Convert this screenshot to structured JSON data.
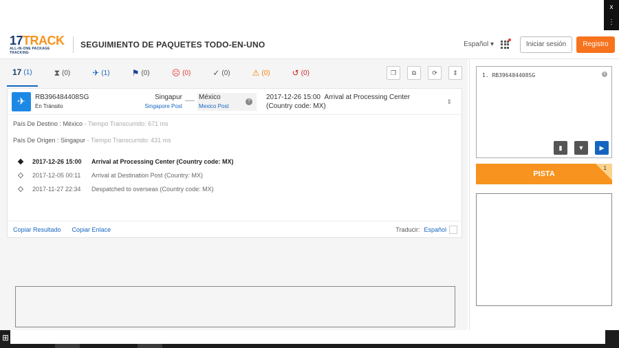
{
  "window": {
    "close": "x",
    "menu": "⋮"
  },
  "header": {
    "logo_main_1": "17",
    "logo_main_2": "TRACK",
    "logo_sub": "ALL-IN-ONE PACKAGE TRACKING",
    "title": "SEGUIMIENTO DE PAQUETES TODO-EN-UNO",
    "language": "Español ▾",
    "login": "Iniciar sesión",
    "register": "Registro"
  },
  "filters": [
    {
      "icon": "17",
      "count": "(1)"
    },
    {
      "icon": "⧗",
      "count": "(0)"
    },
    {
      "icon": "✈",
      "count": "(1)"
    },
    {
      "icon": "⚑",
      "count": "(0)"
    },
    {
      "icon": "☹",
      "count": "(0)"
    },
    {
      "icon": "✓",
      "count": "(0)"
    },
    {
      "icon": "⚠",
      "count": "(0)"
    },
    {
      "icon": "↺",
      "count": "(0)"
    }
  ],
  "shipment": {
    "number": "RB396484408SG",
    "status": "En Tránsito",
    "origin_country": "Singapur",
    "origin_post": "Singapore Post",
    "dest_country": "México",
    "dest_post": "Mexico Post",
    "latest_date": "2017-12-26 15:00",
    "latest_event": "Arrival at Processing Center (Country code: MX)",
    "dest_label": "País De Destino : México",
    "dest_time": " - Tiempo Transcurrido: 671 ms",
    "origin_label": "País De Origen : Singapur",
    "origin_time": " - Tiempo Transcurrido: 431 ms",
    "events": [
      {
        "date": "2017-12-26 15:00",
        "desc": "Arrival at Processing Center (Country code: MX)"
      },
      {
        "date": "2017-12-05 00:11",
        "desc": "Arrival at Destination Post (Country: MX)"
      },
      {
        "date": "2017-11-27 22:34",
        "desc": "Despatched to overseas (Country code: MX)"
      }
    ],
    "copy_result": "Copiar Resultado",
    "copy_link": "Copiar Enlace",
    "translate_label": "Traducir:",
    "translate_lang": "Español"
  },
  "input": {
    "text": "1. RB396484408SG",
    "track_button": "PISTA",
    "badge": "1"
  }
}
